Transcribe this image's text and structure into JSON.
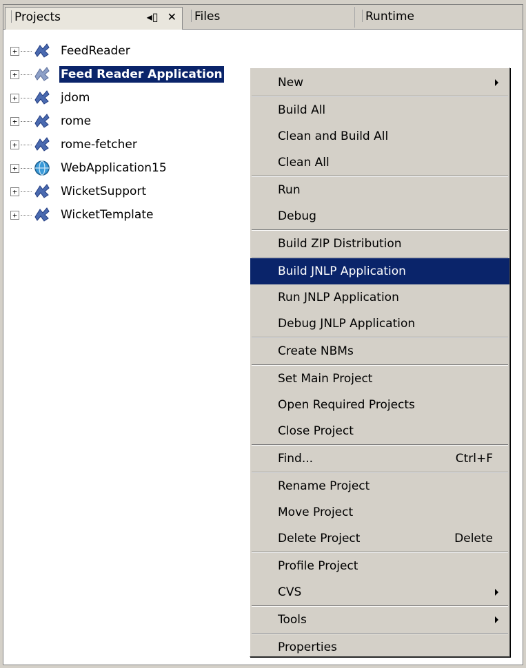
{
  "tabs": [
    {
      "label": "Projects",
      "active": true
    },
    {
      "label": "Files",
      "active": false
    },
    {
      "label": "Runtime",
      "active": false
    }
  ],
  "tab_tools": {
    "minimize_glyph": "◂▯",
    "close_glyph": "✕"
  },
  "tree": {
    "items": [
      {
        "label": "FeedReader",
        "icon": "project-icon",
        "selected": false
      },
      {
        "label": "Feed Reader Application",
        "icon": "project-icon",
        "selected": true
      },
      {
        "label": "jdom",
        "icon": "project-icon",
        "selected": false
      },
      {
        "label": "rome",
        "icon": "project-icon",
        "selected": false
      },
      {
        "label": "rome-fetcher",
        "icon": "project-icon",
        "selected": false
      },
      {
        "label": "WebApplication15",
        "icon": "web-project-icon",
        "selected": false
      },
      {
        "label": "WicketSupport",
        "icon": "project-icon",
        "selected": false
      },
      {
        "label": "WicketTemplate",
        "icon": "project-icon",
        "selected": false
      }
    ],
    "expander_glyph": "+"
  },
  "context_menu": {
    "new": "New",
    "build_all": "Build All",
    "clean_build_all": "Clean and Build All",
    "clean_all": "Clean All",
    "run": "Run",
    "debug": "Debug",
    "build_zip": "Build ZIP Distribution",
    "build_jnlp": "Build JNLP Application",
    "run_jnlp": "Run JNLP Application",
    "debug_jnlp": "Debug JNLP Application",
    "create_nbms": "Create NBMs",
    "set_main": "Set Main Project",
    "open_required": "Open Required Projects",
    "close_project": "Close Project",
    "find": "Find...",
    "find_shortcut": "Ctrl+F",
    "rename": "Rename Project",
    "move": "Move Project",
    "delete": "Delete Project",
    "delete_shortcut": "Delete",
    "profile": "Profile Project",
    "cvs": "CVS",
    "tools": "Tools",
    "properties": "Properties"
  },
  "colors": {
    "selection": "#0a246a",
    "chrome": "#d4d0c8",
    "project_icon": "#4a6ab0",
    "web_icon": "#3a9ad8"
  }
}
